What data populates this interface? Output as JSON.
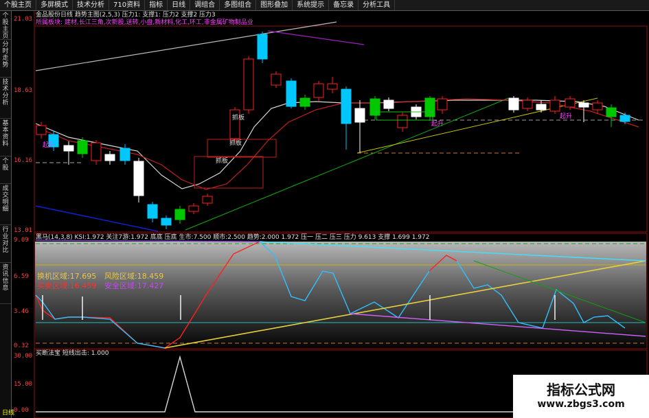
{
  "menu": [
    "个股主页",
    "多屏模式",
    "技术分析",
    "710资料",
    "指标",
    "日线",
    "调组合",
    "多图组合",
    "图形叠加",
    "系统提示",
    "备忘录",
    "分析工具"
  ],
  "left_tabs": [
    "个股主页",
    "分时走势",
    "技术分析",
    "基本资料",
    "个股",
    "成交明细",
    "行业对比",
    "资讯信息"
  ],
  "price_panel": {
    "header1": "金品股份日线  趋势主图(2,5,3)  压力1: 支撑1: 压力2 支撑2 压力3",
    "header2": "所属板块: 建材,长江三角,次新股,送转,小盘,新材料,化工,环工,非金属矿物制品业",
    "axis_ticks": [
      "21.03",
      "18.63",
      "16.16",
      "13.01"
    ],
    "annotations": [
      "抓板",
      "抓板",
      "抓板",
      "起升",
      "起升",
      "起升"
    ]
  },
  "indicator_panel": {
    "header": "黑马(14,3,8) KSI:1.972  关注7游:1.972  底底 压底 生市:7.500  顺市:2.500  趋势:2.000  1.972  压一 压二 压三 压力 9.613  支撑 1.699 1.972",
    "axis_ticks": [
      "9.09",
      "6.59",
      "3.46",
      "0.32"
    ],
    "zones": [
      {
        "label": "换机区域:",
        "value": "17.695",
        "color": "#e8c84a"
      },
      {
        "label": "风险区域:",
        "value": "18.459",
        "color": "#e8c84a"
      },
      {
        "label": "买卖区域:",
        "value": "16.459",
        "color": "#ff3030"
      },
      {
        "label": "安全区域:",
        "value": "17.427",
        "color": "#d040ff"
      }
    ]
  },
  "bottom_panel": {
    "header": "买断法宝  短线出击: 1.000",
    "axis_ticks": [
      "30.00",
      "15.00",
      "0.00"
    ]
  },
  "bottom_status": "日线",
  "watermark": {
    "title": "指标公式网",
    "url": "www.zbgs3.com"
  },
  "colors": {
    "up": "#ff2020",
    "down": "#00c8ff",
    "flat": "#ffffff",
    "green": "#00c800"
  }
}
